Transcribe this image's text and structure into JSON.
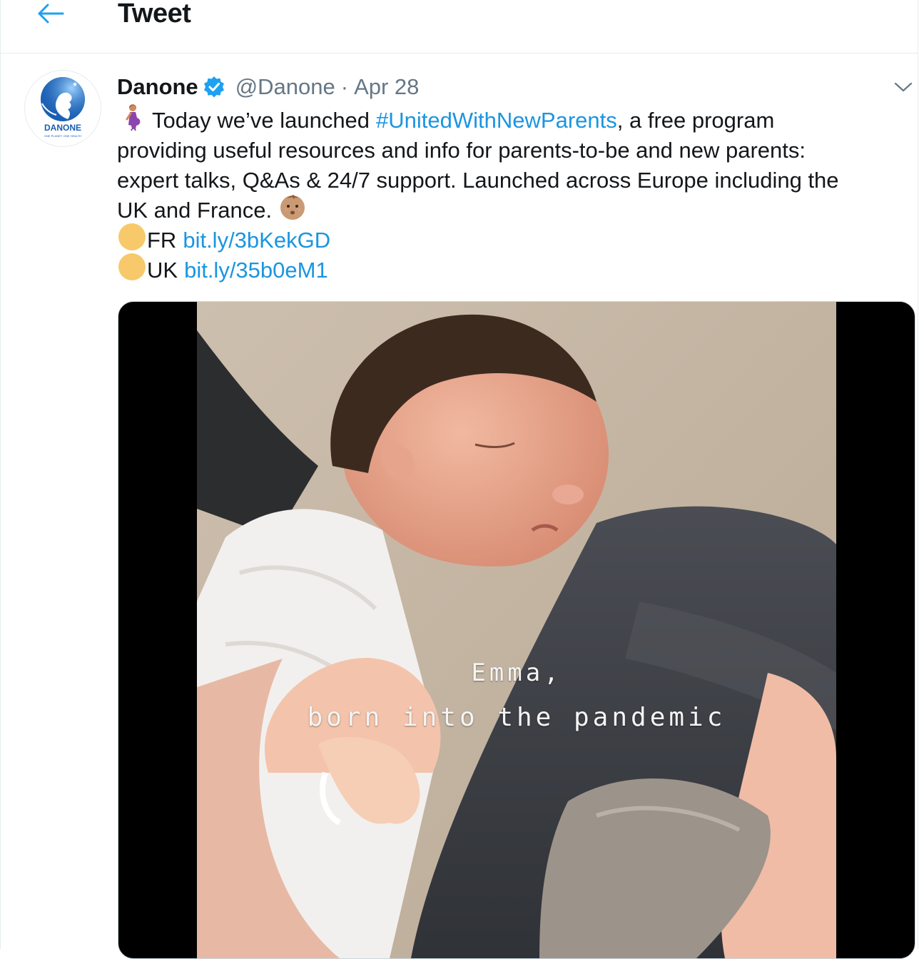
{
  "header": {
    "title": "Tweet",
    "back_icon": "arrow-left-icon"
  },
  "tweet": {
    "author": {
      "display_name": "Danone",
      "handle": "@Danone",
      "verified": true,
      "avatar_logo_text": "DANONE",
      "avatar_logo_subtext": "ONE PLANET. ONE HEALTH"
    },
    "separator": "·",
    "date": "Apr 28",
    "caret_icon": "chevron-down-icon",
    "text": {
      "line1_prefix": "Today we’ve launched",
      "hashtag": "#UnitedWithNewParents",
      "line1_suffix": ", a free program",
      "line2": "providing useful resources and info for parents-to-be and new parents:",
      "line3": "expert talks, Q&As & 24/7 support. Launched across Europe including the",
      "line4": "UK and France.",
      "fr_label": "FR",
      "fr_link": "bit.ly/3bKekGD",
      "uk_label": "UK",
      "uk_link": "bit.ly/35b0eM1"
    },
    "emojis": [
      "pregnant-woman-emoji",
      "baby-emoji",
      "yellow-circle-emoji"
    ],
    "media": {
      "caption_line1": "Emma,",
      "caption_line2": "born into the pandemic"
    }
  },
  "colors": {
    "link": "#1b95e0",
    "text": "#14171a",
    "muted": "#657786",
    "border": "#e6ecf0",
    "verified": "#1da1f2"
  }
}
